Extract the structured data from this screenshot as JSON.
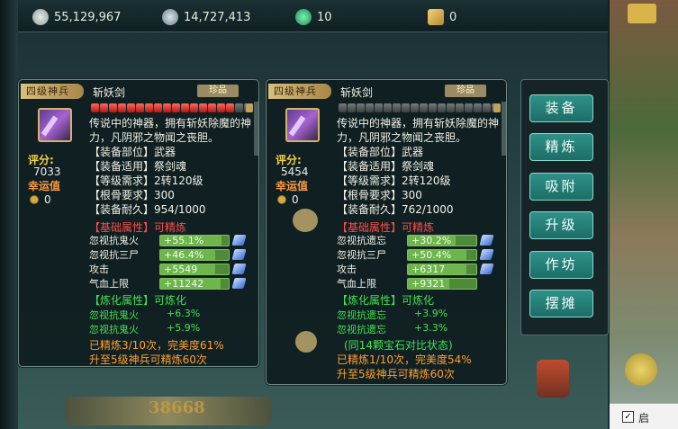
{
  "topbar": {
    "silver": "55,129,967",
    "coins": "14,727,413",
    "jade": "10",
    "tickets": "0"
  },
  "scene": {
    "gold_display": "38668"
  },
  "right_strip": {
    "checkbox_label": "启"
  },
  "left_item": {
    "tier_tag": "四级神兵",
    "name": "斩妖剑",
    "rarity": "珍品",
    "gems_on": 16,
    "gems_total": 18,
    "description": "传说中的神器，拥有斩妖除魔的神力，凡阴邪之物闻之丧胆。",
    "score_label": "评分:",
    "score": "7033",
    "luck_label": "幸运值",
    "luck": "0",
    "info": [
      "【装备部位】武器",
      "【装备适用】祭剑魂",
      "【等级需求】2转120级",
      "【根骨要求】300",
      "【装备耐久】954/1000"
    ],
    "basic_header": "【基础属性】可精炼",
    "basic_attrs": [
      {
        "name": "忽视抗鬼火",
        "value": "+55.1%",
        "fill": 0.9
      },
      {
        "name": "忽视抗三尸",
        "value": "+46.4%",
        "fill": 0.8
      },
      {
        "name": "攻击",
        "value": "+5549",
        "fill": 0.8
      },
      {
        "name": "气血上限",
        "value": "+11242",
        "fill": 0.88
      }
    ],
    "refine_header": "【炼化属性】可炼化",
    "refine_attrs": [
      {
        "name": "忽视抗鬼火",
        "value": "+6.3%"
      },
      {
        "name": "忽视抗鬼火",
        "value": "+5.9%"
      }
    ],
    "footer_1": "已精炼3/10次，完美度61%",
    "footer_2": "升至5级神兵可精炼60次"
  },
  "right_item": {
    "tier_tag": "四级神兵",
    "name": "斩妖剑",
    "rarity": "珍品",
    "gems_on": 0,
    "gems_total": 18,
    "description": "传说中的神器，拥有斩妖除魔的神力，凡阴邪之物闻之丧胆。",
    "score_label": "评分:",
    "score": "5454",
    "luck_label": "幸运值",
    "luck": "0",
    "info": [
      "【装备部位】武器",
      "【装备适用】祭剑魂",
      "【等级需求】2转120级",
      "【根骨要求】300",
      "【装备耐久】762/1000"
    ],
    "basic_header": "【基础属性】可精炼",
    "basic_attrs": [
      {
        "name": "忽视抗遗忘",
        "value": "+30.2%",
        "fill": 0.7
      },
      {
        "name": "忽视抗三尸",
        "value": "+50.4%",
        "fill": 0.85
      },
      {
        "name": "攻击",
        "value": "+6317",
        "fill": 0.85
      },
      {
        "name": "气血上限",
        "value": "+9321",
        "fill": 0.6
      }
    ],
    "refine_header": "【炼化属性】可炼化",
    "refine_attrs": [
      {
        "name": "忽视抗遗忘",
        "value": "+3.9%"
      },
      {
        "name": "忽视抗遗忘",
        "value": "+3.3%"
      }
    ],
    "compare_note": "(同14颗宝石对比状态)",
    "footer_1": "已精炼1/10次，完美度54%",
    "footer_2": "升至5级神兵可精炼60次"
  },
  "menu": [
    "装备",
    "精炼",
    "吸附",
    "升级",
    "作坊",
    "摆摊"
  ],
  "colors": {
    "accent_teal": "#2e9188",
    "gold_label": "#f5d247",
    "refine_green": "#44e055",
    "warning_red": "#ff4b4b",
    "footer_orange": "#ff9f2e"
  }
}
